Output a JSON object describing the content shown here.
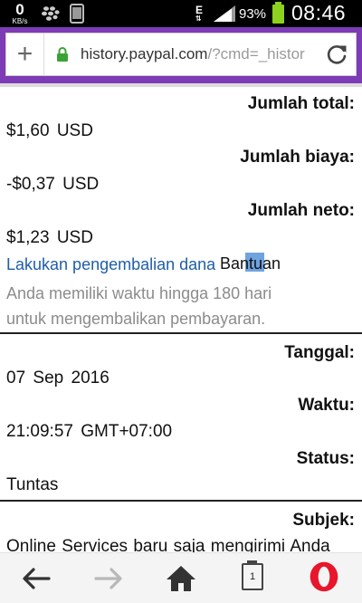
{
  "status_bar": {
    "speed_value": "0",
    "speed_unit": "KB/s",
    "network": "E",
    "battery_percent": "93%",
    "time": "08:46",
    "icons": [
      "bbm-icon",
      "phone-icon",
      "signal-icon",
      "battery-icon"
    ]
  },
  "browser": {
    "url_host": "history.paypal.com",
    "url_path": "/?cmd=_histor",
    "accent_color": "#7d3bb5"
  },
  "details": {
    "total_label": "Jumlah total:",
    "total_value": "$1,60  USD",
    "fee_label": "Jumlah biaya:",
    "fee_value": "-$0,37  USD",
    "net_label": "Jumlah neto:",
    "net_value": "$1,23  USD",
    "refund_link": "Lakukan pengembalian dana",
    "help_tooltip": "Bantuan",
    "refund_note_line1": "Anda memiliki waktu hingga 180 hari",
    "refund_note_line2": "untuk mengembalikan pembayaran.",
    "date_label": "Tanggal:",
    "date_value": "07 Sep 2016",
    "time_label": "Waktu:",
    "time_value": "21:09:57  GMT+07:00",
    "status_label": "Status:",
    "status_value": "Tuntas",
    "subject_label": "Subjek:",
    "subject_value": "Online Services  baru saja mengirimi Anda"
  },
  "toolbar": {
    "tab_count": "1"
  }
}
